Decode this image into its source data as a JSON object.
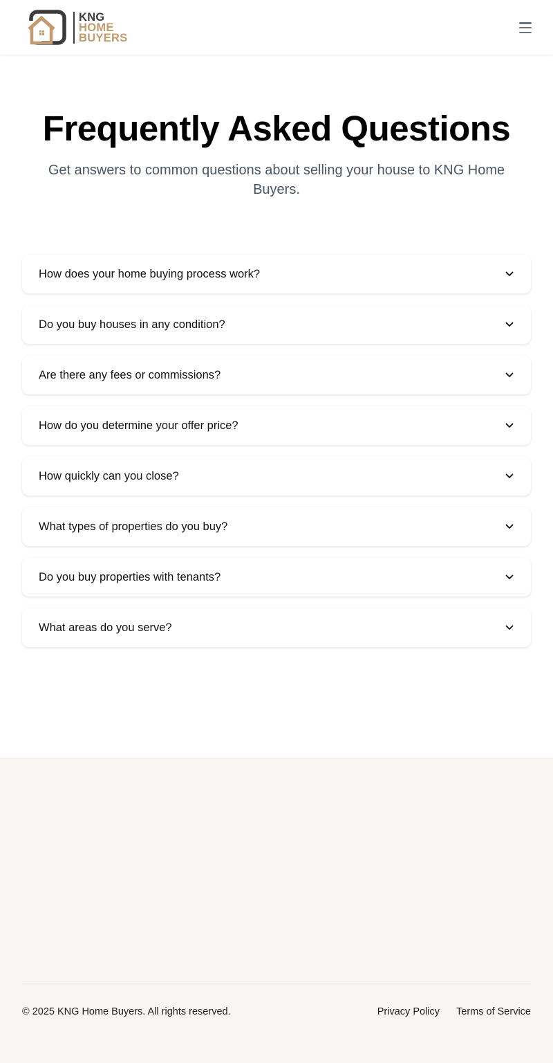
{
  "header": {
    "logo": {
      "line1": "KNG",
      "line2": "HOME",
      "line3": "BUYERS"
    },
    "menu_icon": "hamburger-menu-icon"
  },
  "hero": {
    "title": "Frequently Asked Questions",
    "subtitle": "Get answers to common questions about selling your house to KNG Home Buyers."
  },
  "faq": {
    "items": [
      {
        "question": "How does your home buying process work?",
        "icon": "chevron-down-icon"
      },
      {
        "question": "Do you buy houses in any condition?",
        "icon": "chevron-down-icon"
      },
      {
        "question": "Are there any fees or commissions?",
        "icon": "chevron-down-icon"
      },
      {
        "question": "How do you determine your offer price?",
        "icon": "chevron-down-icon"
      },
      {
        "question": "How quickly can you close?",
        "icon": "chevron-down-icon"
      },
      {
        "question": "What types of properties do you buy?",
        "icon": "chevron-down-icon"
      },
      {
        "question": "Do you buy properties with tenants?",
        "icon": "chevron-down-icon"
      },
      {
        "question": "What areas do you serve?",
        "icon": "chevron-down-icon"
      }
    ]
  },
  "footer": {
    "copyright": "© 2025 KNG Home Buyers. All rights reserved.",
    "links": {
      "privacy": "Privacy Policy",
      "terms": "Terms of Service"
    }
  },
  "colors": {
    "brand_dark": "#3b3b3b",
    "brand_gold": "#c39a6b",
    "subtitle_text": "#4b5563",
    "footer_bg": "#f7f6f2"
  }
}
